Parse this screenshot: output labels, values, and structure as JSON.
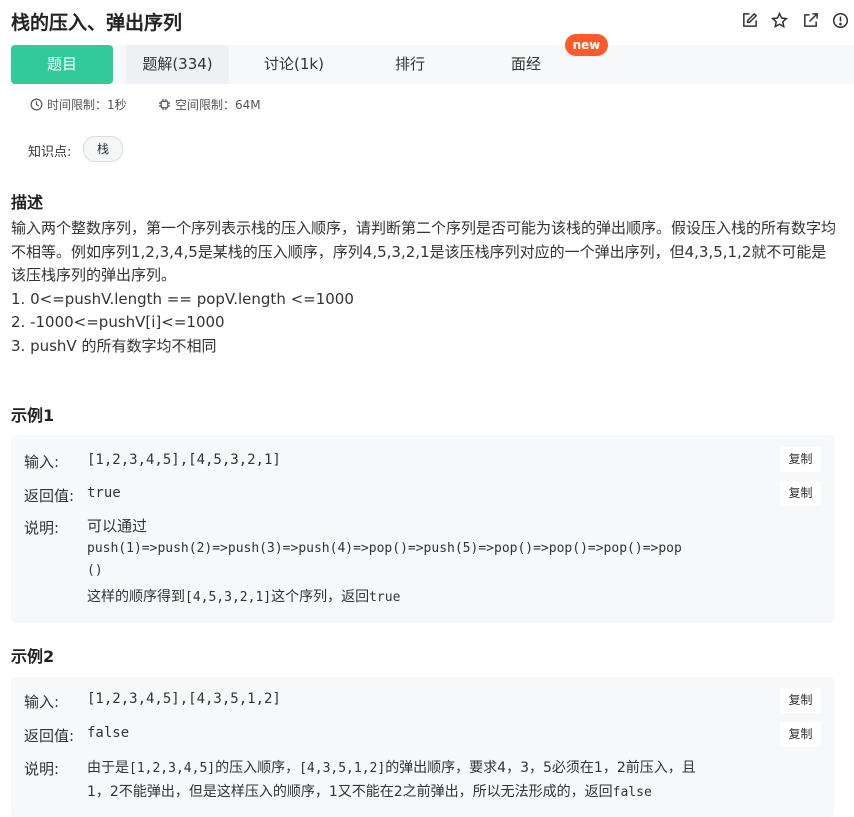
{
  "header": {
    "title": "栈的压入、弹出序列",
    "icons": [
      "edit-icon",
      "star-icon",
      "share-icon",
      "report-icon"
    ]
  },
  "tabs": [
    {
      "label": "题目",
      "active": true
    },
    {
      "label": "题解(334)"
    },
    {
      "label": "讨论(1k)"
    },
    {
      "label": "排行"
    },
    {
      "label": "面经"
    }
  ],
  "new_badge": "new",
  "limits": {
    "time": "时间限制：1秒",
    "space": "空间限制：64M"
  },
  "knowledge": {
    "label": "知识点:",
    "tag": "栈"
  },
  "description": {
    "heading": "描述",
    "paragraph": "输入两个整数序列，第一个序列表示栈的压入顺序，请判断第二个序列是否可能为该栈的弹出顺序。假设压入栈的所有数字均不相等。例如序列1,2,3,4,5是某栈的压入顺序，序列4,5,3,2,1是该压栈序列对应的一个弹出序列，但4,3,5,1,2就不可能是该压栈序列的弹出序列。",
    "constraints": [
      "1. 0<=pushV.length == popV.length <=1000",
      "2. -1000<=pushV[i]<=1000",
      "3. pushV 的所有数字均不相同"
    ]
  },
  "example1": {
    "heading": "示例1",
    "input_label": "输入:",
    "input_value": "[1,2,3,4,5],[4,5,3,2,1]",
    "return_label": "返回值:",
    "return_value": "true",
    "explain_label": "说明:",
    "explain_lines": [
      "可以通过",
      "push(1)=>push(2)=>push(3)=>push(4)=>pop()=>push(5)=>pop()=>pop()=>pop()=>pop",
      "()"
    ],
    "explain_tail": {
      "pre": "这样的顺序得到",
      "seq": "[4,5,3,2,1]",
      "mid": "这个序列，返回",
      "val": "true"
    },
    "copy_label": "复制"
  },
  "example2": {
    "heading": "示例2",
    "input_label": "输入:",
    "input_value": "[1,2,3,4,5],[4,3,5,1,2]",
    "return_label": "返回值:",
    "return_value": "false",
    "explain_label": "说明:",
    "explain_line1": {
      "pre": "由于是",
      "seq1": "[1,2,3,4,5]",
      "mid1": "的压入顺序，",
      "seq2": "[4,3,5,1,2]",
      "post": "的弹出顺序，要求4，3，5必须在1，2前压入，且"
    },
    "explain_line2": {
      "pre": "1，2不能弹出，但是这样压入的顺序，1又不能在2之前弹出，所以无法形成的，返回",
      "val": "false"
    },
    "copy_label": "复制"
  }
}
